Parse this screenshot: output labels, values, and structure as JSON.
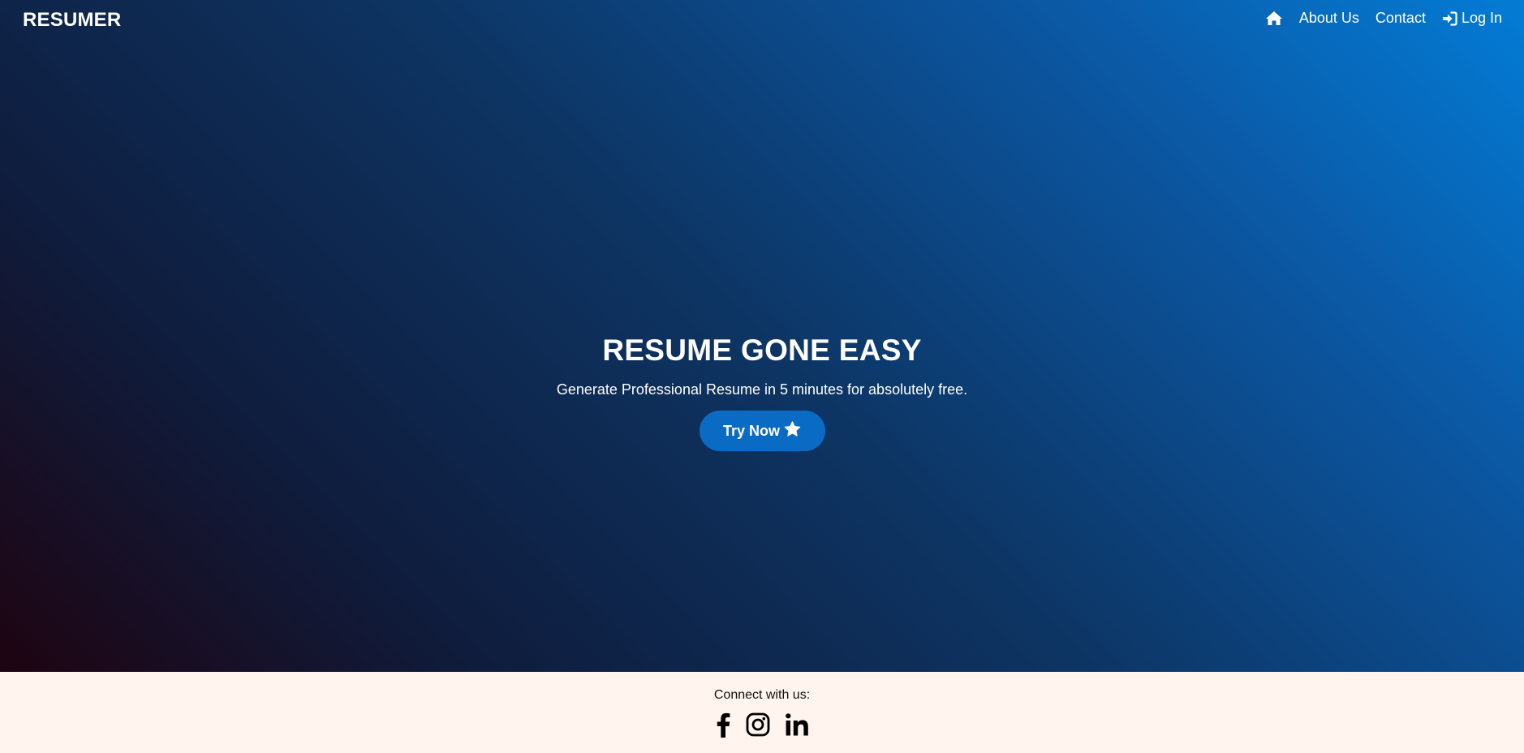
{
  "brand": {
    "name": "RESUMER"
  },
  "nav": {
    "home_icon": "home-icon",
    "about_label": "About Us",
    "contact_label": "Contact",
    "login_label": "Log In",
    "login_icon": "sign-in-icon"
  },
  "hero": {
    "title": "RESUME GONE EASY",
    "subtitle": "Generate Professional Resume in 5 minutes for absolutely free.",
    "cta_label": "Try Now",
    "cta_icon": "star-icon"
  },
  "footer": {
    "text": "Connect with us:",
    "socials": [
      "facebook-icon",
      "instagram-icon",
      "linkedin-icon"
    ]
  },
  "colors": {
    "gradient_start": "#1e0411",
    "gradient_mid": "#0d3564",
    "gradient_end": "#037cd6",
    "cta_background": "#0a6bc4",
    "footer_background": "#fff4ee"
  }
}
